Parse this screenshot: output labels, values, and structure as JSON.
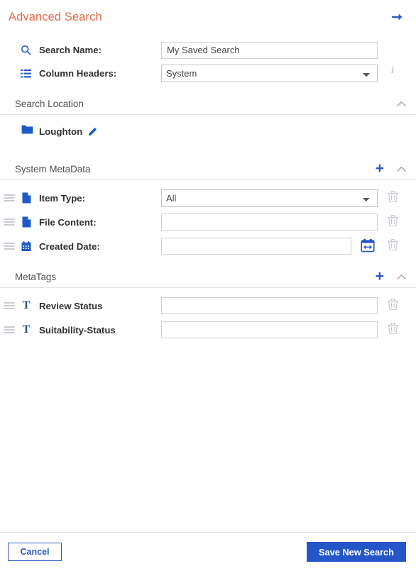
{
  "header": {
    "title": "Advanced Search",
    "forward_icon": "arrow-right-icon"
  },
  "form": {
    "search_name": {
      "icon": "search-icon",
      "label": "Search Name:",
      "value": "My Saved Search",
      "placeholder": ""
    },
    "column_headers": {
      "icon": "list-icon",
      "label": "Column Headers:",
      "value": "System",
      "options": [
        "System"
      ],
      "info_icon": "info-icon"
    }
  },
  "sections": {
    "search_location": {
      "title": "Search Location",
      "collapse_icon": "chevron-up-icon",
      "folder": {
        "icon": "folder-icon",
        "name": "Loughton",
        "edit_icon": "pencil-icon"
      }
    },
    "system_metadata": {
      "title": "System MetaData",
      "add_icon": "plus-icon",
      "collapse_icon": "chevron-up-icon",
      "rows": [
        {
          "drag_icon": "drag-handle-icon",
          "type_icon": "document-icon",
          "label": "Item Type:",
          "control": "select",
          "value": "All",
          "options": [
            "All"
          ],
          "delete_icon": "trash-icon"
        },
        {
          "drag_icon": "drag-handle-icon",
          "type_icon": "document-icon",
          "label": "File Content:",
          "control": "text",
          "value": "",
          "placeholder": "",
          "delete_icon": "trash-icon"
        },
        {
          "drag_icon": "drag-handle-icon",
          "type_icon": "calendar-icon",
          "label": "Created Date:",
          "control": "text",
          "value": "",
          "placeholder": "",
          "picker_icon": "calendar-picker-icon",
          "delete_icon": "trash-icon"
        }
      ]
    },
    "metatags": {
      "title": "MetaTags",
      "add_icon": "plus-icon",
      "collapse_icon": "chevron-up-icon",
      "rows": [
        {
          "drag_icon": "drag-handle-icon",
          "type_icon": "text-tag-icon",
          "type_glyph": "T",
          "label": "Review Status",
          "control": "text",
          "value": "",
          "placeholder": "",
          "delete_icon": "trash-icon"
        },
        {
          "drag_icon": "drag-handle-icon",
          "type_icon": "text-tag-icon",
          "type_glyph": "T",
          "label": "Suitability-Status",
          "control": "text",
          "value": "",
          "placeholder": "",
          "delete_icon": "trash-icon"
        }
      ]
    }
  },
  "footer": {
    "cancel_label": "Cancel",
    "save_label": "Save New Search"
  },
  "colors": {
    "title_orange": "#e2694a",
    "accent_blue": "#2456c8",
    "icon_blue": "#1f5bc4",
    "muted_gray": "#c3c7cc"
  }
}
